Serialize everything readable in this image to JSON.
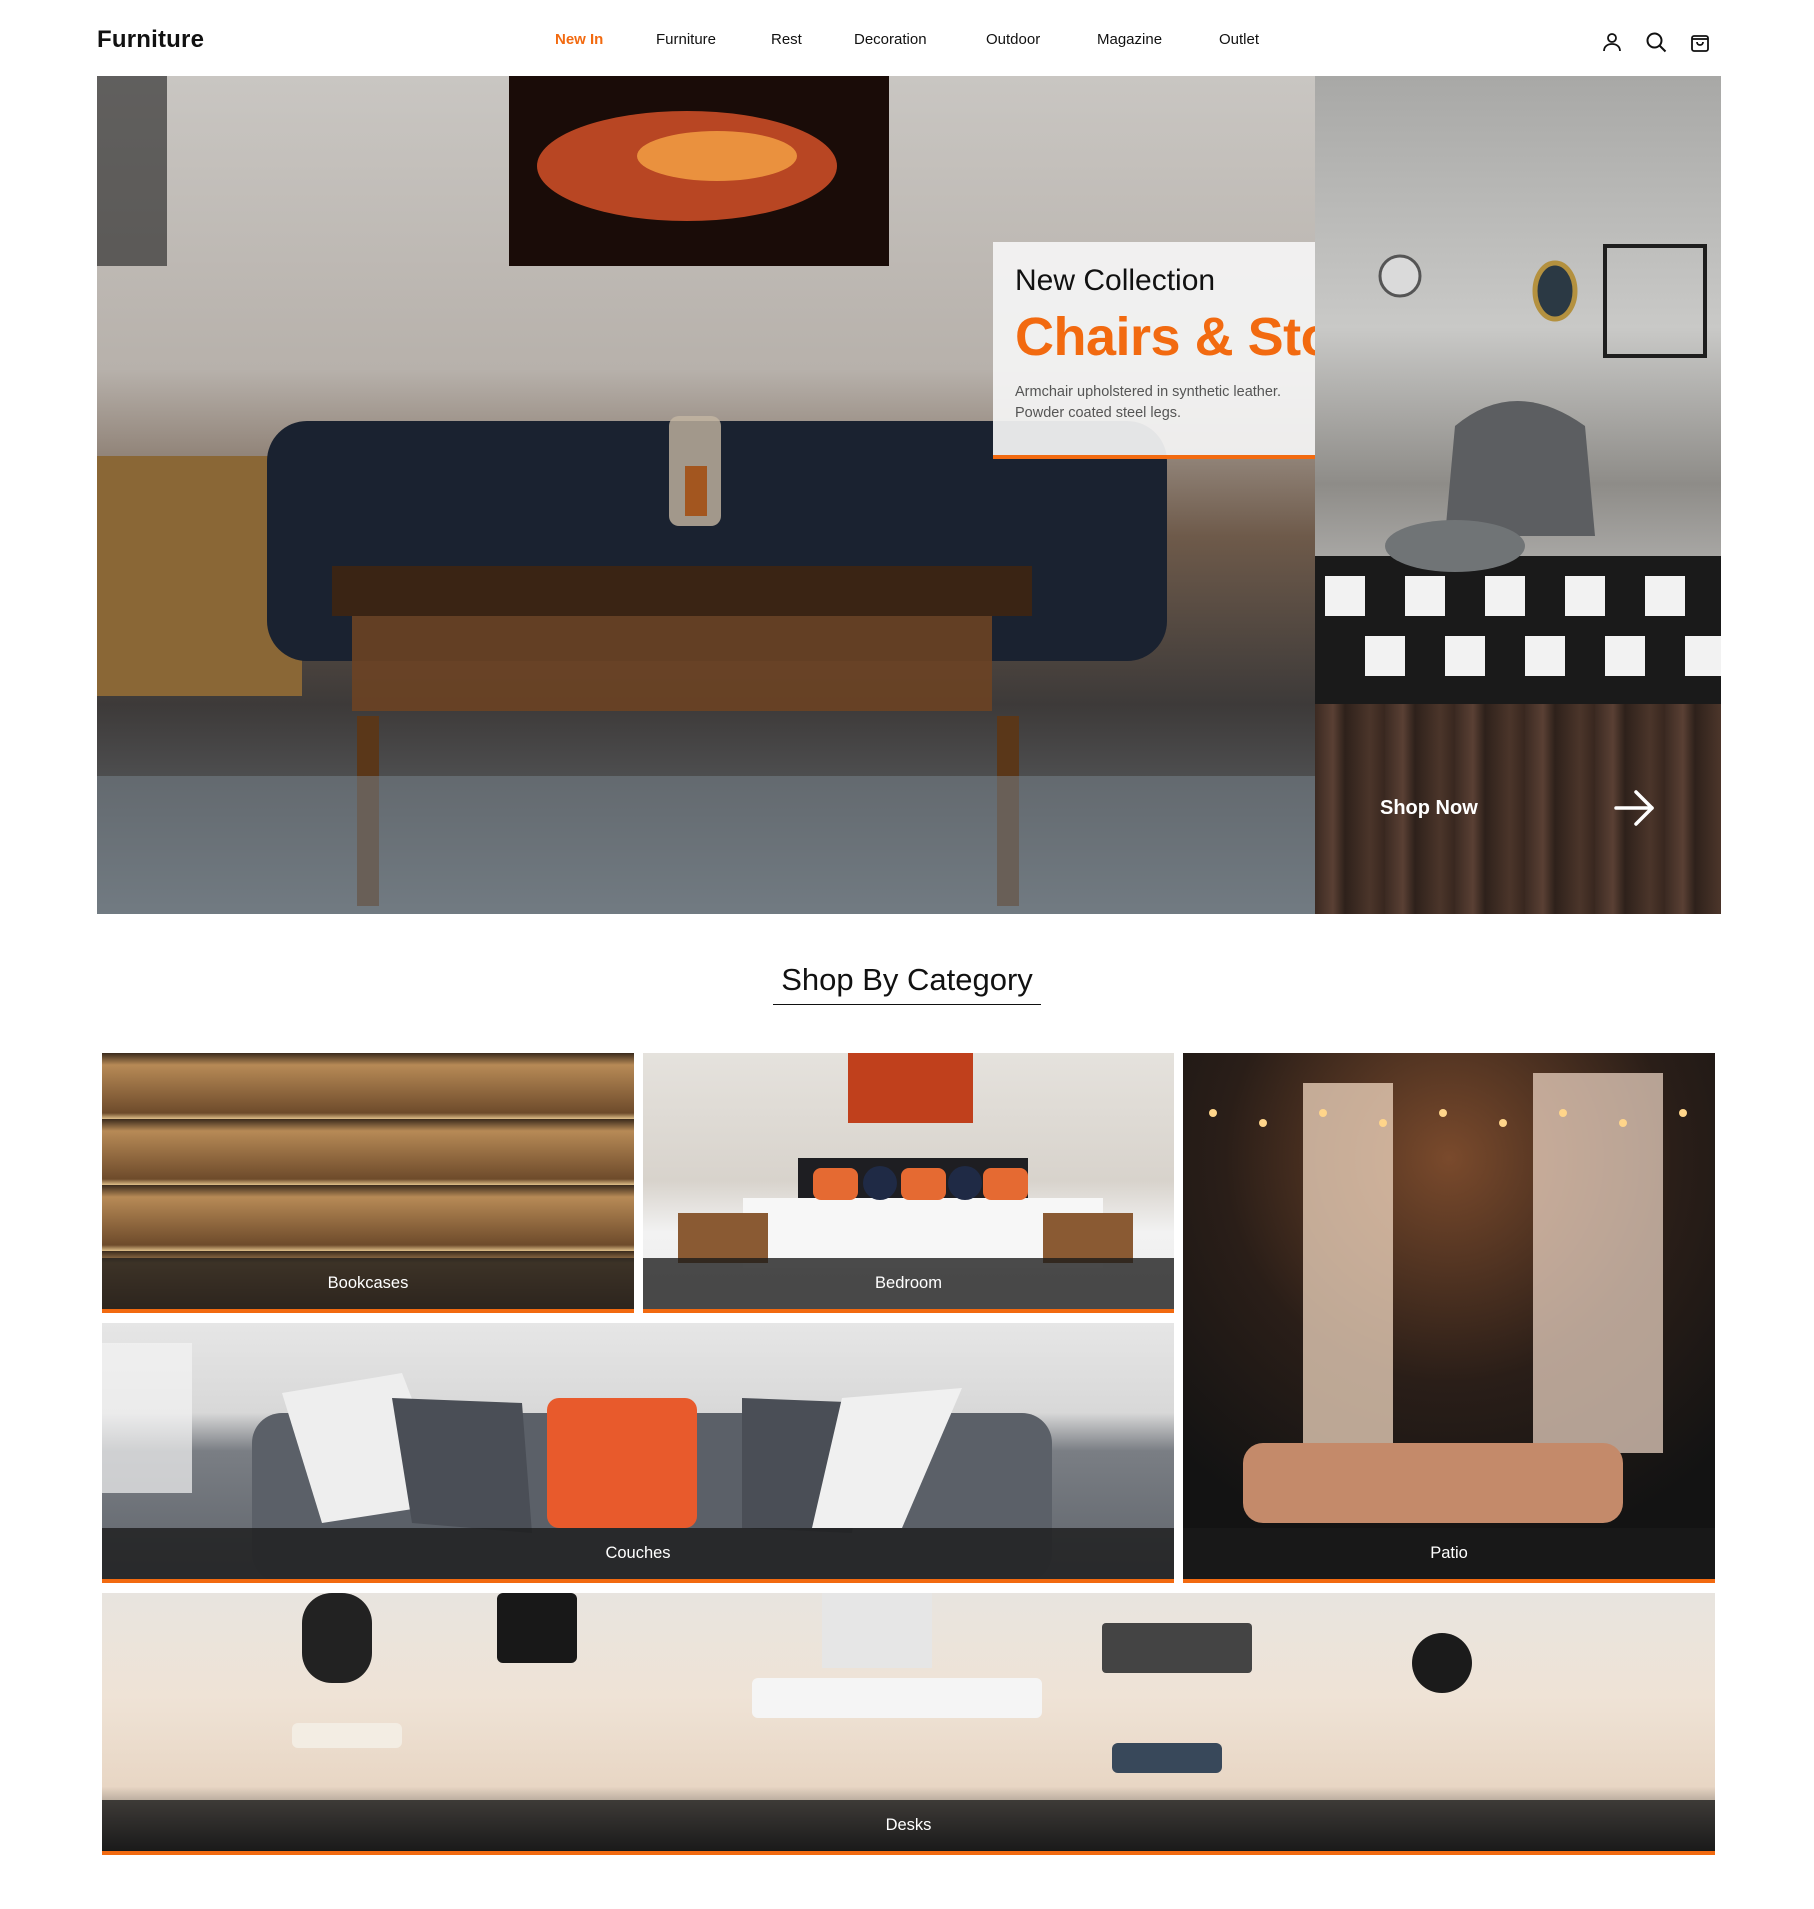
{
  "header": {
    "logo": "Furniture",
    "nav": [
      "New In",
      "Furniture",
      "Rest",
      "Decoration",
      "Outdoor",
      "Magazine",
      "Outlet"
    ],
    "active_nav": "New In",
    "icons": [
      "user-icon",
      "search-icon",
      "shopping-bag-icon"
    ]
  },
  "hero": {
    "kicker": "New Collection",
    "title": "Chairs & Stools",
    "description_line1": "Armchair upholstered in synthetic leather.",
    "description_line2": "Powder coated steel legs.",
    "cta_label": "Shop Now",
    "cta_icon": "arrow-right-icon"
  },
  "section": {
    "title": "Shop By Category"
  },
  "categories": [
    {
      "label": "Bookcases"
    },
    {
      "label": "Bedroom"
    },
    {
      "label": "Couches"
    },
    {
      "label": "Patio"
    },
    {
      "label": "Desks"
    }
  ],
  "colors": {
    "accent": "#f26a10",
    "text": "#111111",
    "overlay_bar": "#191919"
  }
}
